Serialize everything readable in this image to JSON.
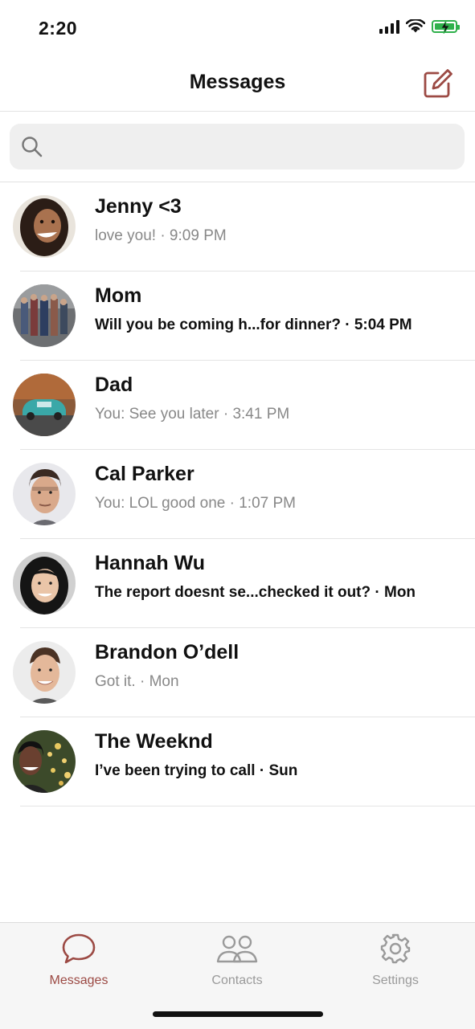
{
  "status": {
    "time": "2:20"
  },
  "header": {
    "title": "Messages"
  },
  "search": {
    "placeholder": ""
  },
  "conversations": [
    {
      "name": "Jenny <3",
      "preview": "love you! · 9:09 PM",
      "unread": false,
      "avatar": "woman-curly-hair-photo"
    },
    {
      "name": "Mom",
      "preview": "Will you be coming h...for dinner?  · 5:04 PM",
      "unread": true,
      "avatar": "family-group-photo"
    },
    {
      "name": "Dad",
      "preview": "You: See you later · 3:41 PM",
      "unread": false,
      "avatar": "vintage-car-photo"
    },
    {
      "name": "Cal Parker",
      "preview": "You: LOL good one · 1:07 PM",
      "unread": false,
      "avatar": "man-portrait-photo"
    },
    {
      "name": "Hannah Wu",
      "preview": "The report doesnt se...checked it out? · Mon",
      "unread": true,
      "avatar": "woman-black-hair-photo"
    },
    {
      "name": "Brandon O’dell",
      "preview": "Got it.  · Mon",
      "unread": false,
      "avatar": "man-smiling-photo"
    },
    {
      "name": "The Weeknd",
      "preview": "I’ve been trying to call · Sun",
      "unread": true,
      "avatar": "man-christmas-tree-photo"
    }
  ],
  "tabs": [
    {
      "label": "Messages",
      "icon": "chat-bubble-icon",
      "active": true
    },
    {
      "label": "Contacts",
      "icon": "people-icon",
      "active": false
    },
    {
      "label": "Settings",
      "icon": "gear-icon",
      "active": false
    }
  ],
  "colors": {
    "accent": "#9c4a44",
    "battery": "#2fb04b",
    "searchBg": "#efefef"
  }
}
